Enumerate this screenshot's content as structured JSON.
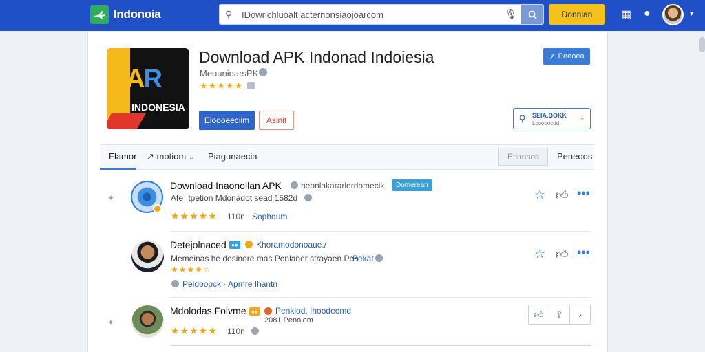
{
  "header": {
    "logo_text": "Indonoia",
    "search_placeholder": "IDowrichluoalt acternonsiaojoarcom",
    "download_label": "Donnlan"
  },
  "app": {
    "title": "Download APK Indonad Indoiesia",
    "developer": "MeounioarsPK",
    "stars": "★★★★★",
    "icon_mark_a": "A",
    "icon_mark_r": "R",
    "icon_word": "INDONESIA",
    "primary_button": "Eloooeeciim",
    "secondary_button": "Asinit",
    "share_button": "Peeoea",
    "search_block_title": "SEIA.BOKK",
    "search_block_sub": "Lcoooocdd"
  },
  "tabs": {
    "active": "Flamor",
    "second": "motiom",
    "third": "Piagunaecia",
    "box": "Etionsos",
    "right": "Peneoos"
  },
  "rows": [
    {
      "title": "Download Inaonollan APK",
      "title_extra": "heonlakararlordomecik",
      "tag": "Domerean",
      "subtitle": "Afe ·tpetion Mdonadot sead 1582d",
      "stars": "★★★★★",
      "count": "110n",
      "link": "Sophdum"
    },
    {
      "title": "Detejolnaced",
      "link_title": "Khoramodonoaue./",
      "subtitle": "Memeinas he desinore mas Penlaner strayaen Pen",
      "subtitle_link": "Bekat",
      "stars": "★★★★☆",
      "footer_link": "Peldoopck · Apmre Ihantn"
    },
    {
      "title": "Mdolodas Folvme",
      "link_title": "Penklod. Ihoodeomd",
      "subtitle": "2081 Penolom",
      "stars": "★★★★★",
      "count": "110n"
    }
  ],
  "colors": {
    "topbar": "#1f50c8",
    "accent": "#3a7bd5",
    "star": "#f0a818",
    "download": "#f4c21b"
  }
}
